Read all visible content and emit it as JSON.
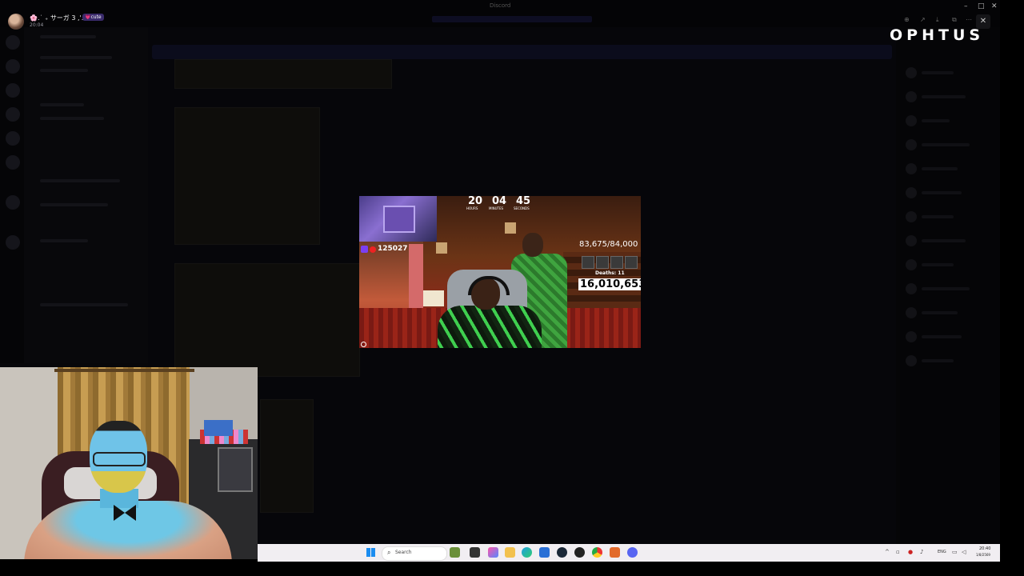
{
  "window": {
    "title": "Discord"
  },
  "streamer": {
    "name": "🌸.˙ ₊ サーガ 3 ,'...",
    "badge": "💗cute",
    "time": "20:04"
  },
  "brand": {
    "logo": "OPHTUS"
  },
  "viewer_toolbar": {
    "close_label": "✕"
  },
  "stream": {
    "timer": {
      "hours": "20",
      "minutes": "04",
      "seconds": "45",
      "hours_label": "HOURS",
      "minutes_label": "MINUTES",
      "seconds_label": "SECONDS"
    },
    "viewer_count": "125027",
    "progress": "83,675/84,000",
    "deaths": "Deaths: 11",
    "counter": "16,010,653"
  },
  "taskbar": {
    "search_placeholder": "Search",
    "apps": [
      "notepad-icon",
      "folder-icon",
      "copilot-icon",
      "edge-icon",
      "file-explorer-icon",
      "store-icon",
      "steam-icon",
      "obs-icon",
      "chrome-icon",
      "game-icon",
      "discord-icon"
    ],
    "tray": {
      "lang": "ENG",
      "time": "20:40",
      "date": "1/8/2569"
    }
  },
  "colors": {
    "taskbar": "#f1eef2",
    "counter_bg": "#ffffff",
    "twitch": "#7b3ff2",
    "brand": "#ffffff"
  }
}
